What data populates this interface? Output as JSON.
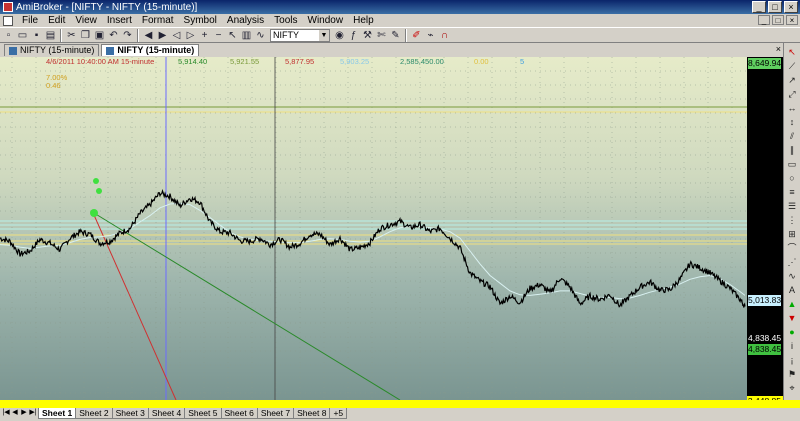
{
  "window": {
    "title": "AmiBroker - [NIFTY - NIFTY (15-minute)]",
    "buttons": [
      "_",
      "□",
      "×"
    ]
  },
  "menu": {
    "items": [
      "File",
      "Edit",
      "View",
      "Insert",
      "Format",
      "Symbol",
      "Analysis",
      "Tools",
      "Window",
      "Help"
    ],
    "mdi_buttons": [
      "_",
      "□",
      "×"
    ]
  },
  "toolbar": {
    "symbol_value": "NIFTY",
    "icons": [
      "new-doc",
      "open-folder",
      "save",
      "print",
      "cut",
      "copy",
      "paste",
      "undo",
      "redo",
      "back",
      "forward",
      "scroll-left",
      "scroll-right",
      "zoom-in",
      "zoom-out",
      "pointer",
      "chart-type",
      "indicator",
      "symbol-combo",
      "eye",
      "formula",
      "hammer",
      "scissors",
      "pen",
      "color",
      "wand"
    ]
  },
  "doc_tabs": [
    {
      "label": "NIFTY (15-minute)",
      "active": false
    },
    {
      "label": "NIFTY (15-minute)",
      "active": true
    }
  ],
  "chart_header": {
    "date": "4/6/2011 10:40:00 AM 15-minute",
    "open": "5,914.40",
    "high": "5,921.55",
    "low": "5,877.95",
    "close": "5,903.25",
    "volume": "2,585,450.00",
    "v1": "0.00",
    "v2": "5",
    "pct1": "7.00%",
    "pct2": "0.46"
  },
  "price_axis": {
    "top": "8,649.94",
    "mid": "5,013.83",
    "current1": "4,838.45",
    "current2": "4,838.45",
    "bottom": "3,448.85"
  },
  "sheet_tabs": {
    "items": [
      "Sheet 1",
      "Sheet 2",
      "Sheet 3",
      "Sheet 4",
      "Sheet 5",
      "Sheet 6",
      "Sheet 7",
      "Sheet 8"
    ],
    "active": "Sheet 1",
    "extra": "+5"
  },
  "colors": {
    "price_line": "#000000",
    "ma_line": "#d8f0f0",
    "trend_green": "#2a8a2a",
    "trend_red": "#d03030",
    "cursor_line": "#6b6bff",
    "hline_green": "#7a9a3a",
    "hline_yellow": "#f0e080",
    "hline_cyan": "#b8f0e8"
  },
  "chart_data": {
    "type": "line",
    "y_range": [
      3448.85,
      8649.94
    ],
    "x": [
      0,
      10,
      20,
      30,
      40,
      50,
      60,
      70,
      80,
      90,
      100,
      110,
      120,
      130,
      140,
      150,
      160,
      170,
      180,
      190,
      200,
      210,
      220,
      230,
      240,
      250,
      260,
      270,
      280,
      290,
      300,
      310,
      320,
      330,
      340,
      350,
      360,
      370,
      380,
      390,
      400,
      410,
      420,
      430,
      440,
      450,
      460,
      470,
      480,
      490,
      500,
      510,
      520,
      530,
      540,
      550,
      560,
      570,
      580,
      590,
      600,
      610,
      620,
      630,
      640,
      650,
      660,
      670,
      680,
      690,
      700,
      710,
      720,
      730,
      740,
      745
    ],
    "series": [
      {
        "values": [
          5900,
          5850,
          5650,
          5700,
          5880,
          5820,
          5720,
          5900,
          6000,
          5960,
          5820,
          5850,
          5980,
          6050,
          6280,
          6420,
          6600,
          6550,
          6400,
          6520,
          6460,
          6150,
          6000,
          5980,
          5860,
          5850,
          5900,
          5800,
          5880,
          5760,
          5820,
          5960,
          5960,
          5800,
          5900,
          5720,
          5750,
          5830,
          6050,
          6110,
          6160,
          6060,
          6110,
          6000,
          6050,
          5900,
          5750,
          5360,
          5230,
          5150,
          4880,
          5000,
          4900,
          5120,
          5180,
          5050,
          5280,
          5140,
          4880,
          5000,
          4950,
          5020,
          4850,
          5000,
          5140,
          5220,
          5090,
          5100,
          5260,
          5500,
          5440,
          5360,
          5240,
          5120,
          4950,
          4838.45
        ]
      },
      {
        "values": [
          5800,
          5790,
          5760,
          5740,
          5760,
          5780,
          5790,
          5830,
          5880,
          5910,
          5920,
          5940,
          5980,
          6050,
          6150,
          6250,
          6370,
          6430,
          6440,
          6420,
          6330,
          6220,
          6100,
          5990,
          5920,
          5880,
          5860,
          5850,
          5840,
          5830,
          5830,
          5850,
          5880,
          5890,
          5880,
          5850,
          5840,
          5850,
          5920,
          6000,
          6060,
          6080,
          6080,
          6060,
          6040,
          6000,
          5900,
          5700,
          5500,
          5320,
          5200,
          5080,
          5020,
          5010,
          5030,
          5050,
          5080,
          5080,
          5040,
          5000,
          4980,
          4980,
          4960,
          4970,
          5010,
          5060,
          5100,
          5140,
          5190,
          5260,
          5300,
          5320,
          5270,
          5180,
          5070,
          5010
        ]
      }
    ]
  }
}
